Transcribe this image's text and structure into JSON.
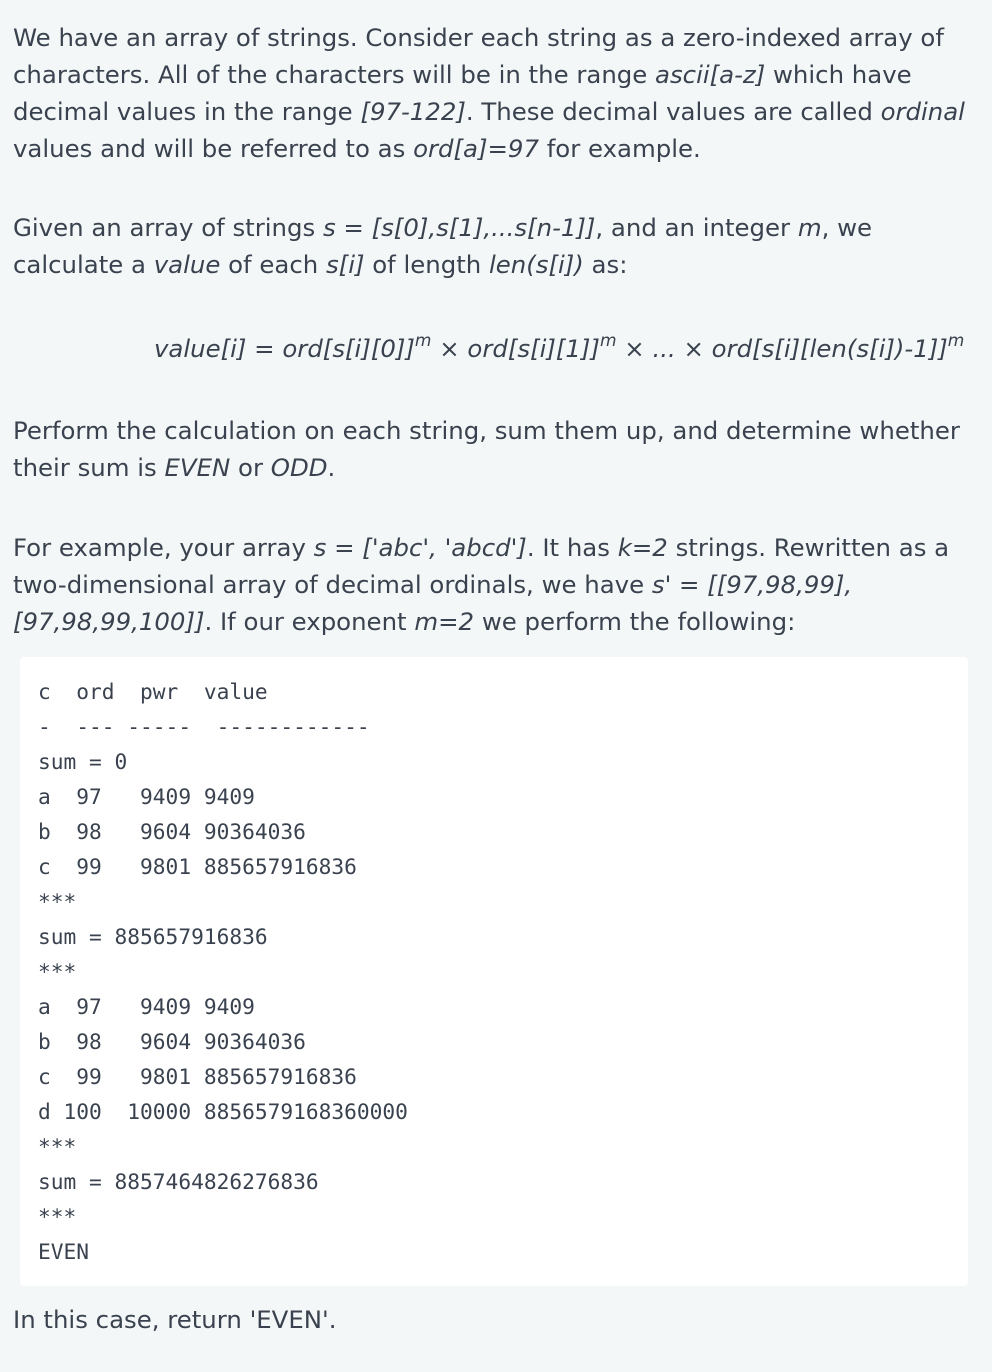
{
  "paragraph1": {
    "t1": "We have an array of strings. Consider each string as a zero-indexed array of characters. All of the characters will be in the range ",
    "i1": "ascii[a-z]",
    "t2": " which have decimal values in the range ",
    "i2": "[97-122]",
    "t3": ". These decimal values are called ",
    "i3": "ordinal",
    "t4": " values and will be referred to as ",
    "i4": "ord[a]=97",
    "t5": " for example."
  },
  "paragraph2": {
    "t1": "Given an array of strings ",
    "i1": "s = [s[0],s[1],...s[n-1]]",
    "t2": ", and an integer ",
    "i2": "m",
    "t3": ", we calculate a ",
    "i3": "value",
    "t4": " of each ",
    "i4": "s[i]",
    "t5": " of length ",
    "i5": "len(s[i])",
    "t6": " as:"
  },
  "formula": {
    "part1": "value[i] = ord[s[i][0]]",
    "sup1": "m",
    "part2": " × ord[s[i][1]]",
    "sup2": "m",
    "part3": " × ... × ord[s[i][len(s[i])-1]]",
    "sup3": "m"
  },
  "paragraph3": {
    "t1": "Perform the calculation on each string, sum them up, and determine whether their sum is ",
    "i1": "EVEN",
    "t2": " or ",
    "i2": "ODD",
    "t3": "."
  },
  "paragraph4": {
    "t1": "For example, your array ",
    "i1": "s = ['abc', 'abcd']",
    "t2": ". It has ",
    "i2": "k=2",
    "t3": " strings. Rewritten as a two-dimensional array of decimal ordinals, we have ",
    "i3": "s' = [[97,98,99],[97,98,99,100]]",
    "t4": ". If our exponent ",
    "i4": "m=2",
    "t5": " we perform the following:"
  },
  "code_block": "c  ord  pwr  value\n-  --- -----  ------------\nsum = 0\na  97   9409 9409\nb  98   9604 90364036\nc  99   9801 885657916836\n***\nsum = 885657916836\n***\na  97   9409 9409\nb  98   9604 90364036\nc  99   9801 885657916836\nd 100  10000 8856579168360000\n***\nsum = 8857464826276836\n***\nEVEN",
  "paragraph5": {
    "t1": "In this case, return 'EVEN'."
  }
}
